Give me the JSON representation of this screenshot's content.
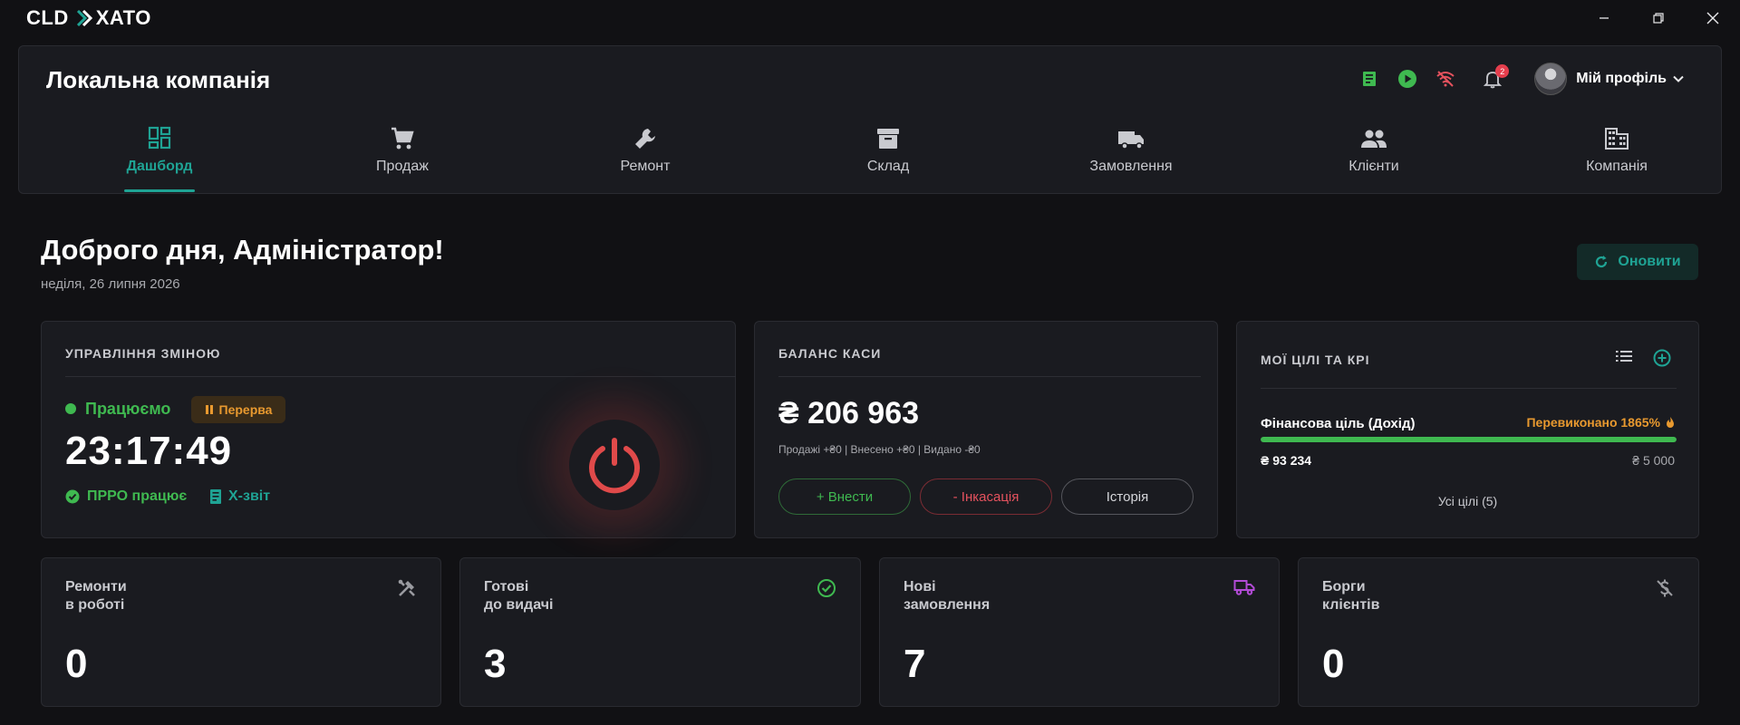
{
  "app": {
    "logo_left": "CLD",
    "logo_right": "XATO"
  },
  "header": {
    "company": "Локальна компанія",
    "notifications_count": "2",
    "profile_label": "Мій профіль"
  },
  "nav": {
    "items": [
      {
        "label": "Дашборд",
        "icon": "dashboard-icon",
        "active": true
      },
      {
        "label": "Продаж",
        "icon": "cart-icon"
      },
      {
        "label": "Ремонт",
        "icon": "wrench-icon"
      },
      {
        "label": "Склад",
        "icon": "archive-icon"
      },
      {
        "label": "Замовлення",
        "icon": "truck-icon"
      },
      {
        "label": "Клієнти",
        "icon": "people-icon"
      },
      {
        "label": "Компанія",
        "icon": "building-icon"
      }
    ]
  },
  "main": {
    "greeting": "Доброго дня, Адміністратор!",
    "date": "неділя, 26 липня 2026",
    "refresh_label": "Оновити"
  },
  "shift": {
    "title": "УПРАВЛІННЯ ЗМІНОЮ",
    "status": "Працюємо",
    "break_label": "Перерва",
    "timer": "23:17:49",
    "prro": "ПРРО працює",
    "xreport": "Х-звіт"
  },
  "balance": {
    "title": "БАЛАНС КАСИ",
    "amount": "₴ 206 963",
    "summary": "Продажі +₴0 | Внесено +₴0 | Видано -₴0",
    "deposit_label": "+ Внести",
    "collect_label": "- Інкасація",
    "history_label": "Історія"
  },
  "goals": {
    "title": "МОЇ ЦІЛІ ТА КРІ",
    "goal_name": "Фінансова ціль (Дохід)",
    "goal_status": "Перевиконано 1865%",
    "progress": 1.0,
    "current": "₴ 93 234",
    "target": "₴ 5 000",
    "all_label": "Усі цілі (5)"
  },
  "stats": [
    {
      "label": "Ремонти\nв роботі",
      "value": "0",
      "icon": "tools-icon"
    },
    {
      "label": "Готові\nдо видачі",
      "value": "3",
      "icon": "check-circle-icon"
    },
    {
      "label": "Нові\nзамовлення",
      "value": "7",
      "icon": "truck-icon"
    },
    {
      "label": "Борги\nклієнтів",
      "value": "0",
      "icon": "no-money-icon"
    }
  ],
  "colors": {
    "accent": "#1fa394",
    "success": "#3fb950",
    "warning": "#e8992f",
    "danger": "#e5525e",
    "purple": "#b24bd6"
  }
}
